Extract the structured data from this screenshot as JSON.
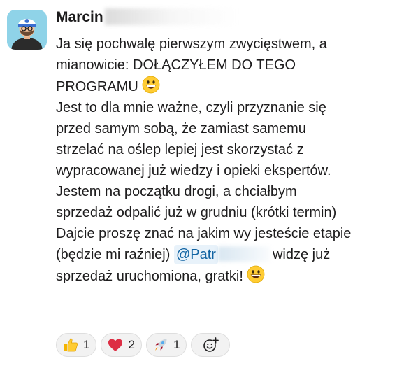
{
  "message": {
    "author_visible": "Marcin",
    "p1_lines": [
      "Ja się pochwalę pierwszym zwycięstwem, a",
      "mianowicie: DOŁĄCZYŁEM DO TEGO",
      "PROGRAMU"
    ],
    "p2_lines": [
      "Jest to dla mnie ważne, czyli przyznanie się",
      "przed samym sobą, że zamiast samemu",
      "strzelać na oślep lepiej jest skorzystać z",
      "wypracowanej już wiedzy i opieki  ekspertów."
    ],
    "p3_lines": [
      "Jestem na początku drogi, a chciałbym",
      "sprzedaż odpalić już w grudniu (krótki termin)"
    ],
    "p4_line1": "Dajcie proszę znać na jakim wy jesteście etapie",
    "p4_line2_before": "(będzie mi raźniej)",
    "mention_visible": "@Patr",
    "p4_line2_after": "widzę już",
    "p4_line3": "sprzedaż uruchomiona, gratki!",
    "inline_emoji": "grinning-face"
  },
  "reactions": [
    {
      "emoji": "thumbs-up",
      "count": "1"
    },
    {
      "emoji": "red-heart",
      "count": "2"
    },
    {
      "emoji": "rocket",
      "count": "1"
    }
  ],
  "add_reaction_icon": "add-emoji-icon",
  "colors": {
    "mention_bg": "#e8f2fa",
    "mention_text": "#1264a3",
    "reaction_bg": "#f2f2f2",
    "avatar_bg": "#8fd3e8"
  }
}
